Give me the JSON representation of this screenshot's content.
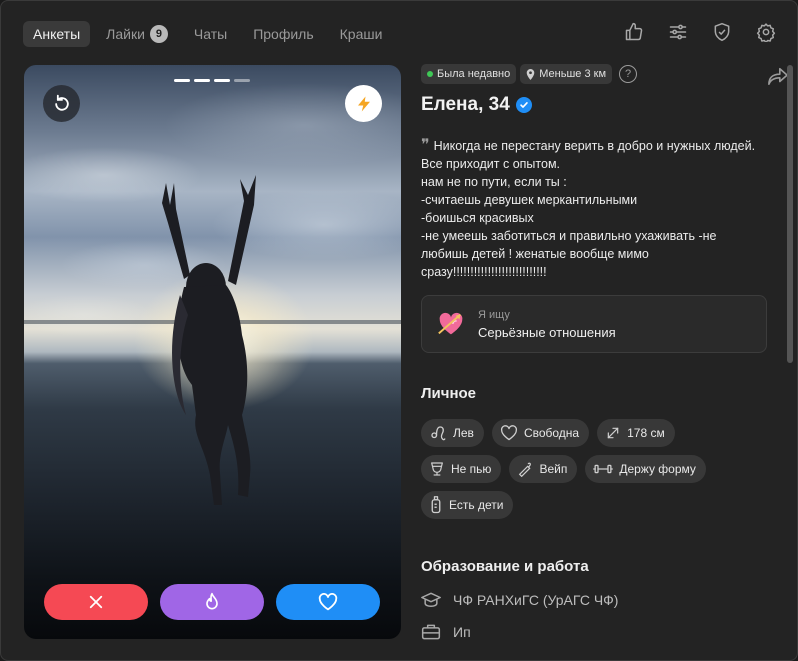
{
  "nav": {
    "tabs": [
      {
        "label": "Анкеты",
        "active": true
      },
      {
        "label": "Лайки",
        "badge": "9"
      },
      {
        "label": "Чаты"
      },
      {
        "label": "Профиль"
      },
      {
        "label": "Краши"
      }
    ],
    "icons": [
      "thumbs-up-icon",
      "sliders-icon",
      "shield-check-icon",
      "gear-icon"
    ]
  },
  "photo": {
    "dots_total": 4,
    "dots_active": 3,
    "rewind_icon": "rewind-icon",
    "boost_icon": "lightning-icon",
    "actions": [
      "close-icon",
      "flame-icon",
      "heart-icon"
    ],
    "colors": {
      "skip": "#f54954",
      "super": "#a066e6",
      "like": "#1f8ef6",
      "boost": "#f5a623"
    }
  },
  "profile": {
    "status": "Была недавно",
    "distance": "Меньше 3 км",
    "help": "?",
    "name": "Елена, 34",
    "bio": "Никогда не перестану верить в добро и нужных людей.\nВсе приходит с опытом.\nнам не по пути, если ты :\n-считаешь девушек меркантильными\n-боишься красивых\n-не умеешь заботиться и правильно ухаживать -не любишь детей ! женатые вообще мимо сразу!!!!!!!!!!!!!!!!!!!!!!!!!!!",
    "looking_for": {
      "label": "Я ищу",
      "value": "Серьёзные отношения"
    }
  },
  "personal": {
    "title": "Личное",
    "tags": [
      {
        "icon": "leo-icon",
        "label": "Лев"
      },
      {
        "icon": "heart-outline-icon",
        "label": "Свободна"
      },
      {
        "icon": "height-icon",
        "label": "178 см"
      },
      {
        "icon": "glass-icon",
        "label": "Не пью"
      },
      {
        "icon": "vape-icon",
        "label": "Вейп"
      },
      {
        "icon": "dumbbell-icon",
        "label": "Держу форму"
      },
      {
        "icon": "baby-bottle-icon",
        "label": "Есть дети"
      }
    ]
  },
  "education": {
    "title": "Образование и работа",
    "items": [
      {
        "icon": "graduation-cap-icon",
        "label": "ЧФ РАНХиГС (УрАГС ЧФ)"
      },
      {
        "icon": "briefcase-icon",
        "label": "Ип"
      }
    ]
  }
}
